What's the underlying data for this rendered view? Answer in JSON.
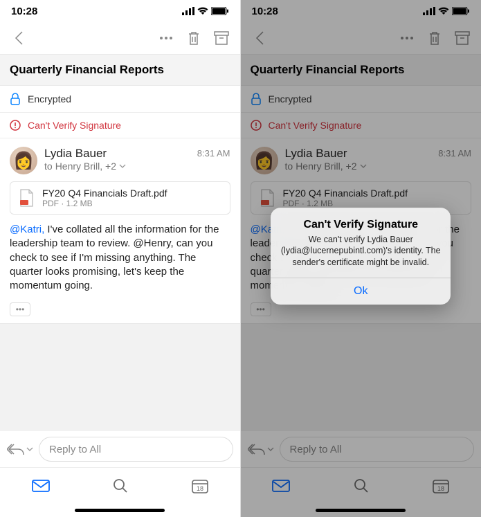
{
  "status": {
    "time": "10:28"
  },
  "subject": "Quarterly Financial Reports",
  "banners": {
    "encrypted": "Encrypted",
    "cant_verify": "Can't Verify Signature"
  },
  "message": {
    "from": "Lydia Bauer",
    "to_prefix": "to ",
    "to": "Henry Brill, +2",
    "time": "8:31 AM",
    "attachment": {
      "name": "FY20 Q4 Financials Draft.pdf",
      "meta": "PDF · 1.2 MB"
    },
    "mention1": "@Katri,",
    "body_after_mention": " I've collated all the information for the leadership team to review. @Henry, can you check to see if I'm missing anything. The quarter looks promising, let's keep the momentum going."
  },
  "reply": {
    "placeholder": "Reply to All"
  },
  "calendar_day": "18",
  "modal": {
    "title": "Can't Verify Signature",
    "text": "We can't verify Lydia Bauer (lydia@lucernepubintl.com)'s identity. The sender's certificate might be invalid.",
    "ok": "Ok"
  }
}
